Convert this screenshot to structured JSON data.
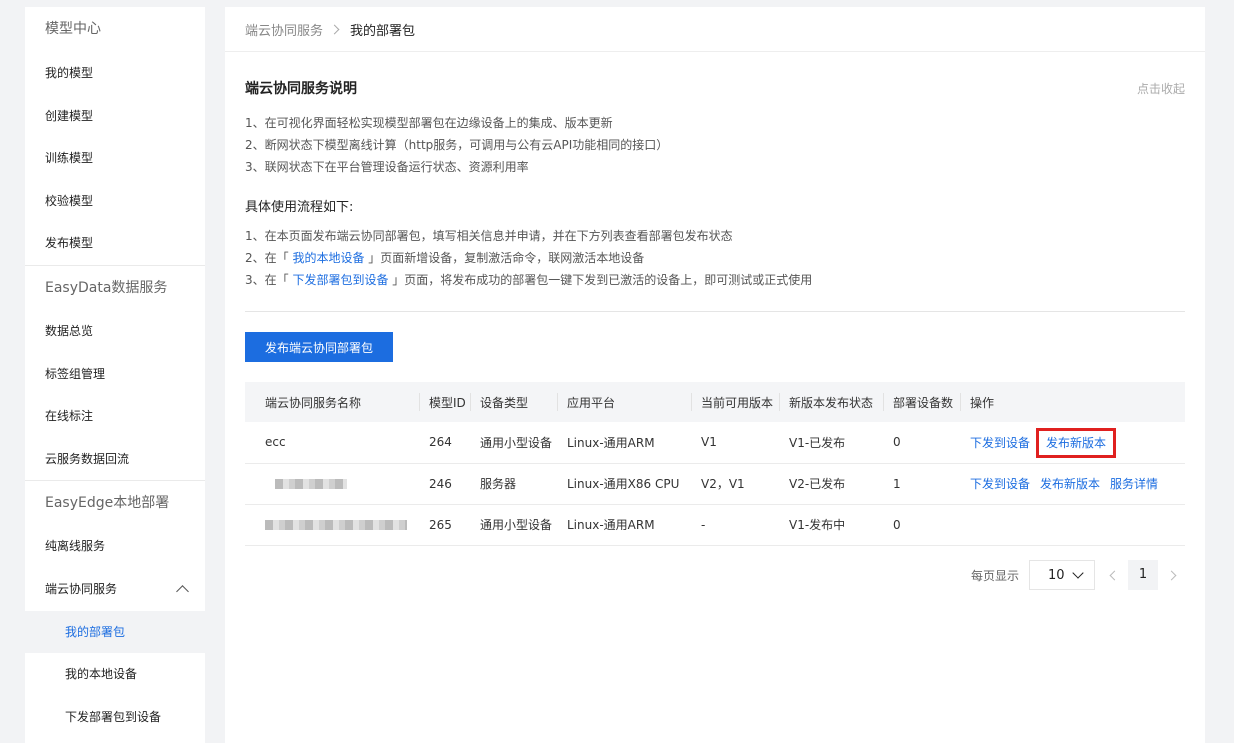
{
  "sidebar": {
    "section1": "模型中心",
    "items1": [
      "我的模型",
      "创建模型",
      "训练模型",
      "校验模型",
      "发布模型"
    ],
    "section2": "EasyData数据服务",
    "items2": [
      "数据总览",
      "标签组管理",
      "在线标注",
      "云服务数据回流"
    ],
    "section3": "EasyEdge本地部署",
    "offline": "纯离线服务",
    "group": "端云协同服务",
    "sub_items": [
      "我的部署包",
      "我的本地设备",
      "下发部署包到设备"
    ]
  },
  "breadcrumb": {
    "parent": "端云协同服务",
    "current": "我的部署包"
  },
  "desc": {
    "title": "端云协同服务说明",
    "collapse": "点击收起",
    "lines": [
      "1、在可视化界面轻松实现模型部署包在边缘设备上的集成、版本更新",
      "2、断网状态下模型离线计算（http服务，可调用与公有云API功能相同的接口）",
      "3、联网状态下在平台管理设备运行状态、资源利用率"
    ],
    "flow_title": "具体使用流程如下:",
    "flow1": "1、在本页面发布端云协同部署包，填写相关信息并申请，并在下方列表查看部署包发布状态",
    "flow2_pre": "2、在「 ",
    "flow2_link": "我的本地设备",
    "flow2_post": " 」页面新增设备，复制激活命令，联网激活本地设备",
    "flow3_pre": "3、在「 ",
    "flow3_link": "下发部署包到设备",
    "flow3_post": " 」页面，将发布成功的部署包一键下发到已激活的设备上，即可测试或正式使用"
  },
  "publish_button": "发布端云协同部署包",
  "table": {
    "headers": [
      "端云协同服务名称",
      "模型ID",
      "设备类型",
      "应用平台",
      "当前可用版本",
      "新版本发布状态",
      "部署设备数",
      "操作"
    ],
    "rows": [
      {
        "name": "ecc",
        "model_id": "264",
        "device": "通用小型设备",
        "platform": "Linux-通用ARM",
        "version": "V1",
        "status": "V1-已发布",
        "count": "0",
        "ops": [
          "下发到设备",
          "发布新版本"
        ]
      },
      {
        "name": "",
        "model_id": "246",
        "device": "服务器",
        "platform": "Linux-通用X86 CPU",
        "version": "V2，V1",
        "status": "V2-已发布",
        "count": "1",
        "ops": [
          "下发到设备",
          "发布新版本",
          "服务详情"
        ]
      },
      {
        "name": "",
        "model_id": "265",
        "device": "通用小型设备",
        "platform": "Linux-通用ARM",
        "version": "-",
        "status": "V1-发布中",
        "count": "0",
        "ops": []
      }
    ]
  },
  "pager": {
    "label": "每页显示",
    "page_size": "10",
    "current_page": "1"
  },
  "colors": {
    "accent": "#1c6de0",
    "highlight_box": "#e0201f"
  }
}
